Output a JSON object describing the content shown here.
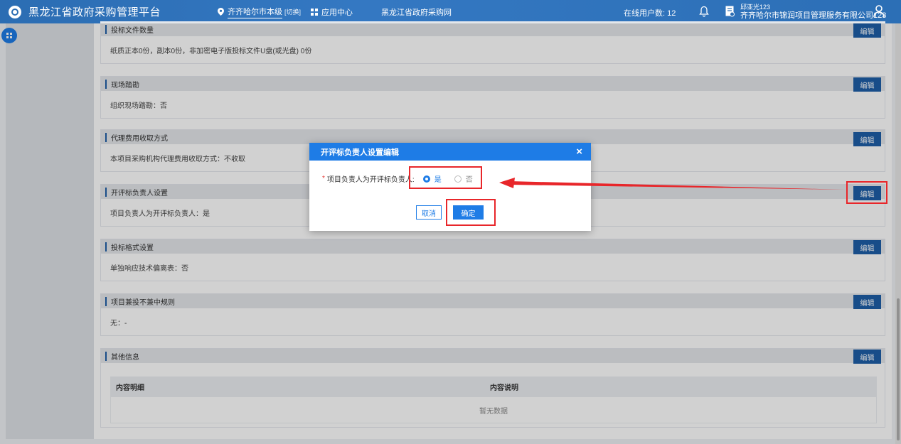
{
  "header": {
    "platform_title": "黑龙江省政府采购管理平台",
    "region": "齐齐哈尔市本级",
    "switch": "[切换]",
    "app_center": "应用中心",
    "gov_site": "黑龙江省政府采购网",
    "online_users": "在线用户数: 12",
    "user_name": "邱亚光123",
    "company": "齐齐哈尔市锦润项目管理服务有限公司123"
  },
  "sections": [
    {
      "title": "投标文件数量",
      "body": "纸质正本0份，副本0份，非加密电子版投标文件U盘(或光盘) 0份"
    },
    {
      "title": "现场踏勘",
      "body": "组织现场踏勘：否"
    },
    {
      "title": "代理费用收取方式",
      "body": "本项目采购机构代理费用收取方式：不收取"
    },
    {
      "title": "开评标负责人设置",
      "body": "项目负责人为开评标负责人：是"
    },
    {
      "title": "投标格式设置",
      "body": "单独响应技术偏离表：否"
    },
    {
      "title": "项目兼投不兼中规则",
      "body": "无：-"
    },
    {
      "title": "其他信息",
      "body": ""
    }
  ],
  "edit_label": "编辑",
  "table": {
    "col1": "内容明细",
    "col2": "内容说明",
    "empty": "暂无数据"
  },
  "modal": {
    "title": "开评标负责人设置编辑",
    "required_mark": "*",
    "field_label": "项目负责人为开评标负责人:",
    "option_yes": "是",
    "option_no": "否",
    "cancel": "取消",
    "ok": "确定"
  },
  "colors": {
    "primary": "#1e7ce6",
    "header_bg": "#2b6db3",
    "edit_button": "#1e5fa8",
    "highlight": "#e8262a"
  }
}
